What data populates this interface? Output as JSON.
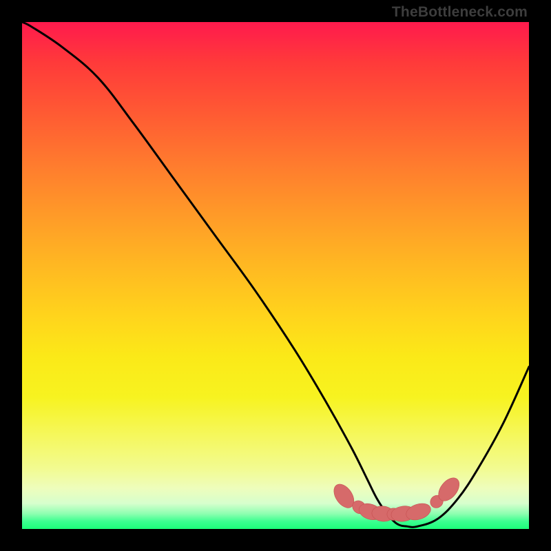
{
  "watermark": "TheBottleneck.com",
  "colors": {
    "background": "#000000",
    "curve": "#000000",
    "marker_fill": "#d66a6a",
    "marker_stroke": "#c65050"
  },
  "chart_data": {
    "type": "line",
    "title": "",
    "subtitle": "",
    "xlabel": "",
    "ylabel": "",
    "xlim": [
      0,
      100
    ],
    "ylim": [
      0,
      100
    ],
    "grid": false,
    "legend": false,
    "annotations": [],
    "series": [
      {
        "name": "bottleneck-curve",
        "x": [
          0,
          2,
          8,
          15,
          22,
          30,
          38,
          46,
          54,
          60,
          65,
          68,
          70,
          72,
          74,
          76,
          78,
          82,
          86,
          90,
          95,
          100
        ],
        "values": [
          100,
          99,
          95,
          89,
          80,
          69,
          58,
          47,
          35,
          25,
          16,
          10,
          6,
          3,
          1,
          0.5,
          0.5,
          2,
          6,
          12,
          21,
          32
        ]
      }
    ],
    "markers": [
      {
        "x": 63.5,
        "y": 6.5,
        "sx": 2.6,
        "sy": 1.6,
        "rot": 56
      },
      {
        "x": 66.5,
        "y": 4.3,
        "sx": 1.4,
        "sy": 1.2,
        "rot": 40
      },
      {
        "x": 68.7,
        "y": 3.4,
        "sx": 2.3,
        "sy": 1.5,
        "rot": 18
      },
      {
        "x": 71.2,
        "y": 3.0,
        "sx": 2.2,
        "sy": 1.5,
        "rot": 6
      },
      {
        "x": 73.3,
        "y": 2.9,
        "sx": 1.3,
        "sy": 1.2,
        "rot": 0
      },
      {
        "x": 75.2,
        "y": 3.0,
        "sx": 2.4,
        "sy": 1.5,
        "rot": -8
      },
      {
        "x": 78.2,
        "y": 3.4,
        "sx": 2.5,
        "sy": 1.5,
        "rot": -18
      },
      {
        "x": 81.8,
        "y": 5.4,
        "sx": 1.3,
        "sy": 1.2,
        "rot": -40
      },
      {
        "x": 84.2,
        "y": 7.8,
        "sx": 2.6,
        "sy": 1.6,
        "rot": -52
      }
    ]
  }
}
